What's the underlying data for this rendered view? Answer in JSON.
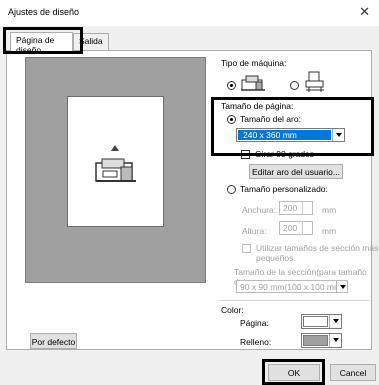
{
  "window": {
    "title": "Ajustes de diseño"
  },
  "tabs": [
    {
      "label": "Página de diseño"
    },
    {
      "label": "Salida"
    }
  ],
  "machine_type": {
    "label": "Tipo de máquina:",
    "selected": "embroidery"
  },
  "page_size": {
    "label": "Tamaño de página:",
    "hoop_radio_label": "Tamaño del aro:",
    "hoop_value": "240 x 360 mm",
    "rotate_label": "Girar 90 grados",
    "edit_hoop_button": "Editar aro del usuario...",
    "custom_radio_label": "Tamaño personalizado:",
    "width_label": "Anchura:",
    "width_value": "200",
    "height_label": "Altura:",
    "height_value": "200",
    "unit": "mm",
    "section_check_label_1": "Utilizar tamaños de sección más",
    "section_check_label_2": "pequeños.",
    "section_size_label": "Tamaño de la sección(para tamaño del",
    "section_size_value": "90 x  90 mm(100 x 100 mm"
  },
  "color": {
    "label": "Color:",
    "page_label": "Página:",
    "page_color": "#ffffff",
    "fill_label": "Relleno:",
    "fill_color": "#a0a0a0"
  },
  "buttons": {
    "default": "Por defecto",
    "ok": "OK",
    "cancel": "Cancel"
  }
}
